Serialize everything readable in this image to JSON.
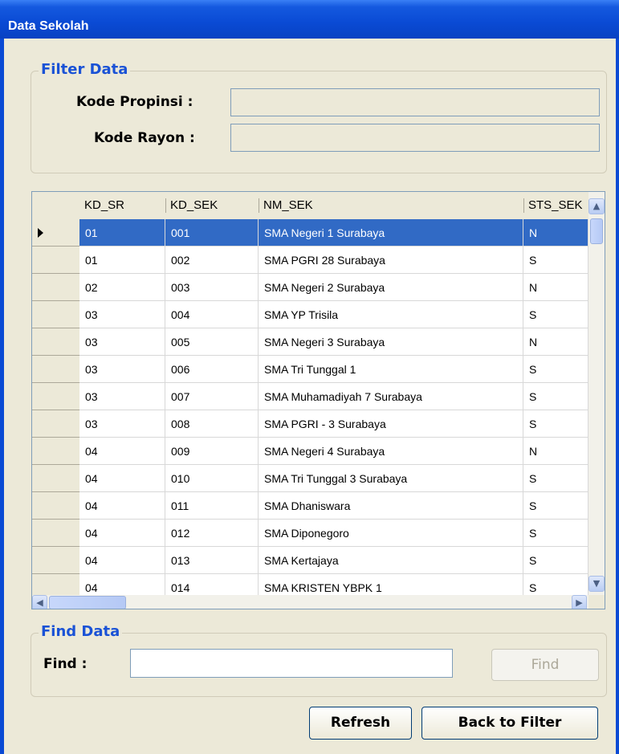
{
  "window": {
    "title": "Data Sekolah"
  },
  "filter": {
    "legend": "Filter Data",
    "kode_propinsi_label": "Kode Propinsi :",
    "kode_propinsi_value": "",
    "kode_rayon_label": "Kode Rayon :",
    "kode_rayon_value": ""
  },
  "grid": {
    "columns": [
      "KD_SR",
      "KD_SEK",
      "NM_SEK",
      "STS_SEK"
    ],
    "rows": [
      [
        "01",
        "001",
        "SMA Negeri 1 Surabaya",
        "N"
      ],
      [
        "01",
        "002",
        "SMA PGRI 28 Surabaya",
        "S"
      ],
      [
        "02",
        "003",
        "SMA Negeri 2 Surabaya",
        "N"
      ],
      [
        "03",
        "004",
        "SMA YP Trisila",
        "S"
      ],
      [
        "03",
        "005",
        "SMA Negeri 3 Surabaya",
        "N"
      ],
      [
        "03",
        "006",
        "SMA Tri Tunggal 1",
        "S"
      ],
      [
        "03",
        "007",
        "SMA Muhamadiyah 7 Surabaya",
        "S"
      ],
      [
        "03",
        "008",
        "SMA PGRI - 3 Surabaya",
        "S"
      ],
      [
        "04",
        "009",
        "SMA Negeri 4 Surabaya",
        "N"
      ],
      [
        "04",
        "010",
        "SMA Tri Tunggal 3 Surabaya",
        "S"
      ],
      [
        "04",
        "011",
        "SMA Dhaniswara",
        "S"
      ],
      [
        "04",
        "012",
        "SMA Diponegoro",
        "S"
      ],
      [
        "04",
        "013",
        "SMA Kertajaya",
        "S"
      ],
      [
        "04",
        "014",
        "SMA KRISTEN YBPK 1",
        "S"
      ]
    ],
    "selected_row": 0
  },
  "find": {
    "legend": "Find Data",
    "label": "Find :",
    "value": "",
    "button": "Find"
  },
  "buttons": {
    "refresh": "Refresh",
    "back": "Back to Filter"
  },
  "colors": {
    "title_bar": "#0a4ad4",
    "selection": "#316ac5",
    "legend_text": "#1a52d6"
  }
}
